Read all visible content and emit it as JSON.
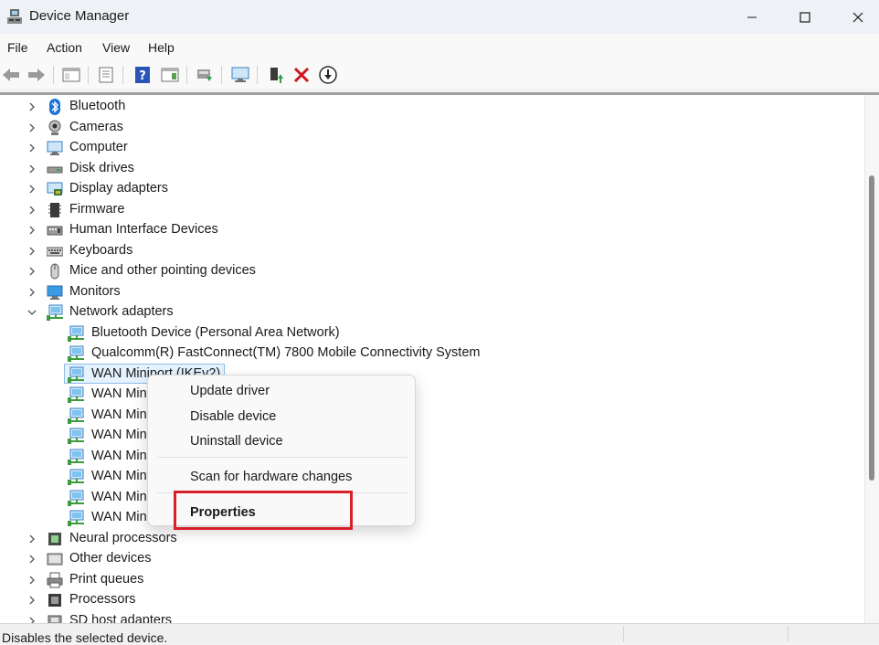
{
  "window": {
    "title": "Device Manager"
  },
  "menu": [
    "File",
    "Action",
    "View",
    "Help"
  ],
  "tree": {
    "categories_top": [
      {
        "label": "Bluetooth",
        "icon": "bluetooth-icon"
      },
      {
        "label": "Cameras",
        "icon": "camera-icon"
      },
      {
        "label": "Computer",
        "icon": "computer-icon"
      },
      {
        "label": "Disk drives",
        "icon": "disk-drive-icon"
      },
      {
        "label": "Display adapters",
        "icon": "display-adapter-icon"
      },
      {
        "label": "Firmware",
        "icon": "firmware-icon"
      },
      {
        "label": "Human Interface Devices",
        "icon": "hid-icon"
      },
      {
        "label": "Keyboards",
        "icon": "keyboard-icon"
      },
      {
        "label": "Mice and other pointing devices",
        "icon": "mouse-icon"
      },
      {
        "label": "Monitors",
        "icon": "monitor-icon"
      }
    ],
    "network_adapters": {
      "label": "Network adapters",
      "expanded": true,
      "children": [
        "Bluetooth Device (Personal Area Network)",
        "Qualcomm(R) FastConnect(TM) 7800 Mobile Connectivity System",
        "WAN Miniport (IKEv2)",
        "WAN Min",
        "WAN Min",
        "WAN Min",
        "WAN Min",
        "WAN Min",
        "WAN Min",
        "WAN Min"
      ],
      "selected_index": 2
    },
    "categories_bottom": [
      {
        "label": "Neural processors",
        "icon": "chip-icon"
      },
      {
        "label": "Other devices",
        "icon": "other-devices-icon"
      },
      {
        "label": "Print queues",
        "icon": "printer-icon"
      },
      {
        "label": "Processors",
        "icon": "processor-icon"
      },
      {
        "label": "SD host adapters",
        "icon": "sd-adapter-icon"
      }
    ]
  },
  "context_menu": {
    "update": "Update driver",
    "disable": "Disable device",
    "uninstall": "Uninstall device",
    "scan": "Scan for hardware changes",
    "properties": "Properties"
  },
  "status": {
    "text": "Disables the selected device."
  },
  "colors": {
    "highlight": "#d8202a",
    "selection": "#e5f3ff"
  }
}
